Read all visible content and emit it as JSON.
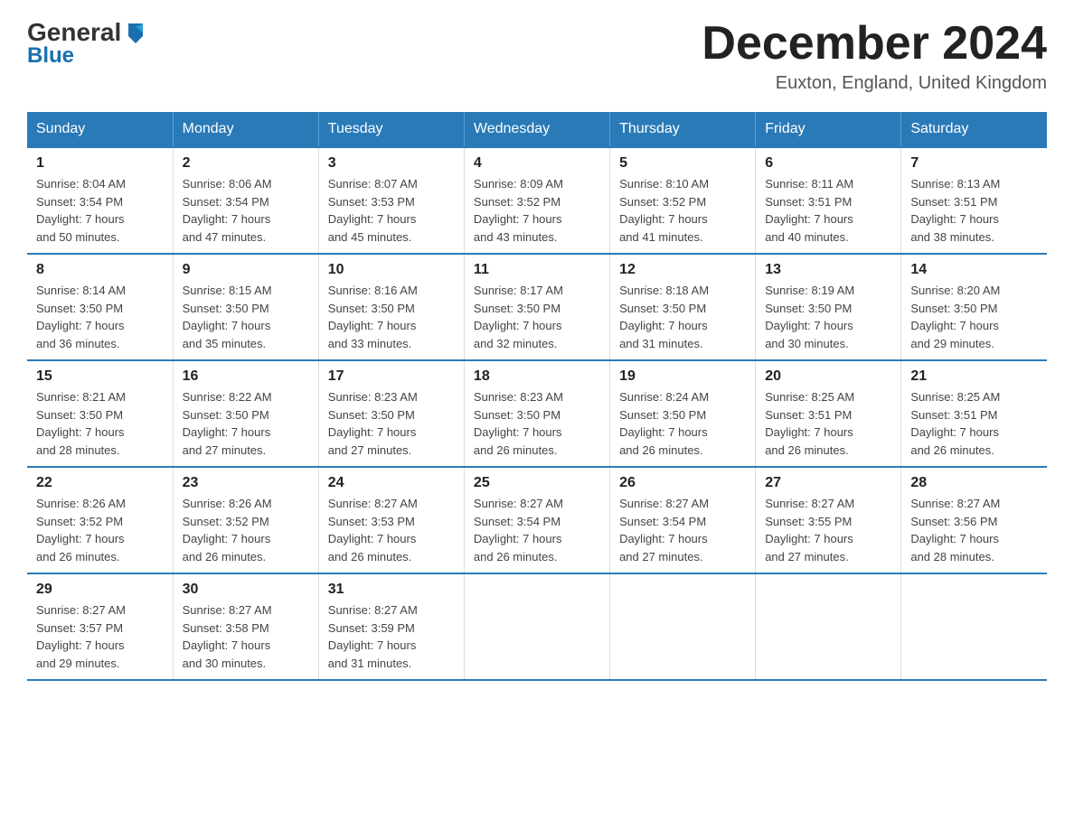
{
  "header": {
    "logo_general": "General",
    "logo_blue": "Blue",
    "title": "December 2024",
    "subtitle": "Euxton, England, United Kingdom"
  },
  "calendar": {
    "headers": [
      "Sunday",
      "Monday",
      "Tuesday",
      "Wednesday",
      "Thursday",
      "Friday",
      "Saturday"
    ],
    "weeks": [
      [
        {
          "day": "1",
          "sunrise": "Sunrise: 8:04 AM",
          "sunset": "Sunset: 3:54 PM",
          "daylight": "Daylight: 7 hours",
          "daylight2": "and 50 minutes."
        },
        {
          "day": "2",
          "sunrise": "Sunrise: 8:06 AM",
          "sunset": "Sunset: 3:54 PM",
          "daylight": "Daylight: 7 hours",
          "daylight2": "and 47 minutes."
        },
        {
          "day": "3",
          "sunrise": "Sunrise: 8:07 AM",
          "sunset": "Sunset: 3:53 PM",
          "daylight": "Daylight: 7 hours",
          "daylight2": "and 45 minutes."
        },
        {
          "day": "4",
          "sunrise": "Sunrise: 8:09 AM",
          "sunset": "Sunset: 3:52 PM",
          "daylight": "Daylight: 7 hours",
          "daylight2": "and 43 minutes."
        },
        {
          "day": "5",
          "sunrise": "Sunrise: 8:10 AM",
          "sunset": "Sunset: 3:52 PM",
          "daylight": "Daylight: 7 hours",
          "daylight2": "and 41 minutes."
        },
        {
          "day": "6",
          "sunrise": "Sunrise: 8:11 AM",
          "sunset": "Sunset: 3:51 PM",
          "daylight": "Daylight: 7 hours",
          "daylight2": "and 40 minutes."
        },
        {
          "day": "7",
          "sunrise": "Sunrise: 8:13 AM",
          "sunset": "Sunset: 3:51 PM",
          "daylight": "Daylight: 7 hours",
          "daylight2": "and 38 minutes."
        }
      ],
      [
        {
          "day": "8",
          "sunrise": "Sunrise: 8:14 AM",
          "sunset": "Sunset: 3:50 PM",
          "daylight": "Daylight: 7 hours",
          "daylight2": "and 36 minutes."
        },
        {
          "day": "9",
          "sunrise": "Sunrise: 8:15 AM",
          "sunset": "Sunset: 3:50 PM",
          "daylight": "Daylight: 7 hours",
          "daylight2": "and 35 minutes."
        },
        {
          "day": "10",
          "sunrise": "Sunrise: 8:16 AM",
          "sunset": "Sunset: 3:50 PM",
          "daylight": "Daylight: 7 hours",
          "daylight2": "and 33 minutes."
        },
        {
          "day": "11",
          "sunrise": "Sunrise: 8:17 AM",
          "sunset": "Sunset: 3:50 PM",
          "daylight": "Daylight: 7 hours",
          "daylight2": "and 32 minutes."
        },
        {
          "day": "12",
          "sunrise": "Sunrise: 8:18 AM",
          "sunset": "Sunset: 3:50 PM",
          "daylight": "Daylight: 7 hours",
          "daylight2": "and 31 minutes."
        },
        {
          "day": "13",
          "sunrise": "Sunrise: 8:19 AM",
          "sunset": "Sunset: 3:50 PM",
          "daylight": "Daylight: 7 hours",
          "daylight2": "and 30 minutes."
        },
        {
          "day": "14",
          "sunrise": "Sunrise: 8:20 AM",
          "sunset": "Sunset: 3:50 PM",
          "daylight": "Daylight: 7 hours",
          "daylight2": "and 29 minutes."
        }
      ],
      [
        {
          "day": "15",
          "sunrise": "Sunrise: 8:21 AM",
          "sunset": "Sunset: 3:50 PM",
          "daylight": "Daylight: 7 hours",
          "daylight2": "and 28 minutes."
        },
        {
          "day": "16",
          "sunrise": "Sunrise: 8:22 AM",
          "sunset": "Sunset: 3:50 PM",
          "daylight": "Daylight: 7 hours",
          "daylight2": "and 27 minutes."
        },
        {
          "day": "17",
          "sunrise": "Sunrise: 8:23 AM",
          "sunset": "Sunset: 3:50 PM",
          "daylight": "Daylight: 7 hours",
          "daylight2": "and 27 minutes."
        },
        {
          "day": "18",
          "sunrise": "Sunrise: 8:23 AM",
          "sunset": "Sunset: 3:50 PM",
          "daylight": "Daylight: 7 hours",
          "daylight2": "and 26 minutes."
        },
        {
          "day": "19",
          "sunrise": "Sunrise: 8:24 AM",
          "sunset": "Sunset: 3:50 PM",
          "daylight": "Daylight: 7 hours",
          "daylight2": "and 26 minutes."
        },
        {
          "day": "20",
          "sunrise": "Sunrise: 8:25 AM",
          "sunset": "Sunset: 3:51 PM",
          "daylight": "Daylight: 7 hours",
          "daylight2": "and 26 minutes."
        },
        {
          "day": "21",
          "sunrise": "Sunrise: 8:25 AM",
          "sunset": "Sunset: 3:51 PM",
          "daylight": "Daylight: 7 hours",
          "daylight2": "and 26 minutes."
        }
      ],
      [
        {
          "day": "22",
          "sunrise": "Sunrise: 8:26 AM",
          "sunset": "Sunset: 3:52 PM",
          "daylight": "Daylight: 7 hours",
          "daylight2": "and 26 minutes."
        },
        {
          "day": "23",
          "sunrise": "Sunrise: 8:26 AM",
          "sunset": "Sunset: 3:52 PM",
          "daylight": "Daylight: 7 hours",
          "daylight2": "and 26 minutes."
        },
        {
          "day": "24",
          "sunrise": "Sunrise: 8:27 AM",
          "sunset": "Sunset: 3:53 PM",
          "daylight": "Daylight: 7 hours",
          "daylight2": "and 26 minutes."
        },
        {
          "day": "25",
          "sunrise": "Sunrise: 8:27 AM",
          "sunset": "Sunset: 3:54 PM",
          "daylight": "Daylight: 7 hours",
          "daylight2": "and 26 minutes."
        },
        {
          "day": "26",
          "sunrise": "Sunrise: 8:27 AM",
          "sunset": "Sunset: 3:54 PM",
          "daylight": "Daylight: 7 hours",
          "daylight2": "and 27 minutes."
        },
        {
          "day": "27",
          "sunrise": "Sunrise: 8:27 AM",
          "sunset": "Sunset: 3:55 PM",
          "daylight": "Daylight: 7 hours",
          "daylight2": "and 27 minutes."
        },
        {
          "day": "28",
          "sunrise": "Sunrise: 8:27 AM",
          "sunset": "Sunset: 3:56 PM",
          "daylight": "Daylight: 7 hours",
          "daylight2": "and 28 minutes."
        }
      ],
      [
        {
          "day": "29",
          "sunrise": "Sunrise: 8:27 AM",
          "sunset": "Sunset: 3:57 PM",
          "daylight": "Daylight: 7 hours",
          "daylight2": "and 29 minutes."
        },
        {
          "day": "30",
          "sunrise": "Sunrise: 8:27 AM",
          "sunset": "Sunset: 3:58 PM",
          "daylight": "Daylight: 7 hours",
          "daylight2": "and 30 minutes."
        },
        {
          "day": "31",
          "sunrise": "Sunrise: 8:27 AM",
          "sunset": "Sunset: 3:59 PM",
          "daylight": "Daylight: 7 hours",
          "daylight2": "and 31 minutes."
        },
        null,
        null,
        null,
        null
      ]
    ]
  }
}
